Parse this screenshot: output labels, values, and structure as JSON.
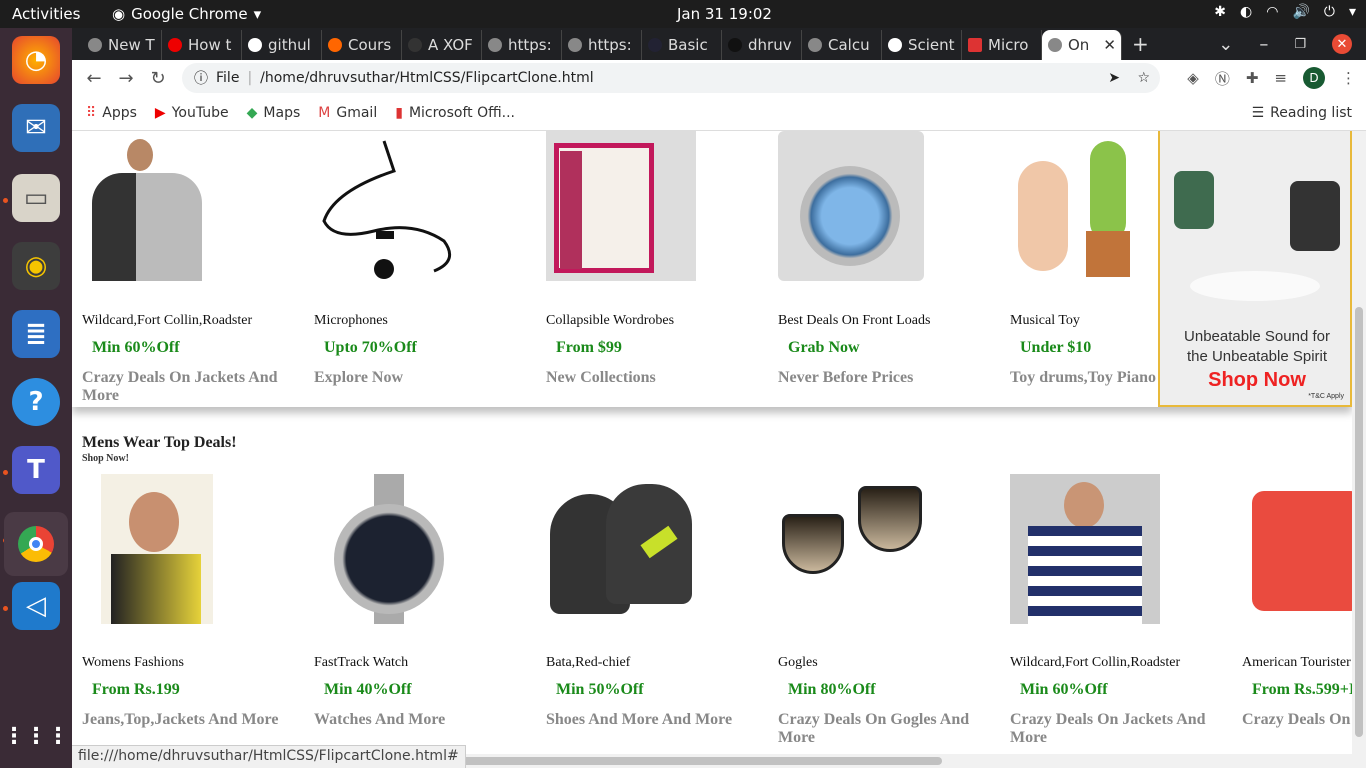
{
  "system": {
    "activities": "Activities",
    "app_name": "Google Chrome",
    "clock": "Jan 31  19:02"
  },
  "tabs": [
    "New T",
    "How t",
    "githul",
    "Cours",
    "A XOF",
    "https:",
    "https:",
    "Basic",
    "dhruv",
    "Calcu",
    "Scient",
    "Micro",
    "On"
  ],
  "address": {
    "file_label": "File",
    "url": "/home/dhruvsuthar/HtmlCSS/FlipcartClone.html",
    "profile_initial": "D"
  },
  "bookmarks": [
    "Apps",
    "YouTube",
    "Maps",
    "Gmail",
    "Microsoft Offi..."
  ],
  "reading_list": "Reading list",
  "row1": [
    {
      "title": "Wildcard,Fort Collin,Roadster",
      "offer": "Min 60%Off",
      "sub": "Crazy Deals On Jackets And More"
    },
    {
      "title": "Microphones",
      "offer": "Upto 70%Off",
      "sub": "Explore Now"
    },
    {
      "title": "Collapsible Wordrobes",
      "offer": "From $99",
      "sub": "New Collections"
    },
    {
      "title": "Best Deals On Front Loads",
      "offer": "Grab Now",
      "sub": "Never Before Prices"
    },
    {
      "title": "Musical Toy",
      "offer": "Under $10",
      "sub": "Toy drums,Toy Piano"
    }
  ],
  "ad": {
    "line1": "Unbeatable Sound for",
    "line2": "the Unbeatable Spirit",
    "cta": "Shop Now",
    "tc": "*T&C Apply"
  },
  "section": {
    "title": "Mens Wear Top Deals!",
    "subtitle": "Shop Now!"
  },
  "row2": [
    {
      "title": "Womens Fashions",
      "offer": "From Rs.199",
      "sub": "Jeans,Top,Jackets And More"
    },
    {
      "title": "FastTrack Watch",
      "offer": "Min 40%Off",
      "sub": "Watches And More"
    },
    {
      "title": "Bata,Red-chief",
      "offer": "Min 50%Off",
      "sub": "Shoes And More And More"
    },
    {
      "title": "Gogles",
      "offer": "Min 80%Off",
      "sub": "Crazy Deals On Gogles And More"
    },
    {
      "title": "Wildcard,Fort Collin,Roadster",
      "offer": "Min 60%Off",
      "sub": "Crazy Deals On Jackets And More"
    },
    {
      "title": "American Tourister",
      "offer": "From Rs.599+I",
      "sub": "Crazy Deals On"
    }
  ],
  "status_url": "file:///home/dhruvsuthar/HtmlCSS/FlipcartClone.html#"
}
